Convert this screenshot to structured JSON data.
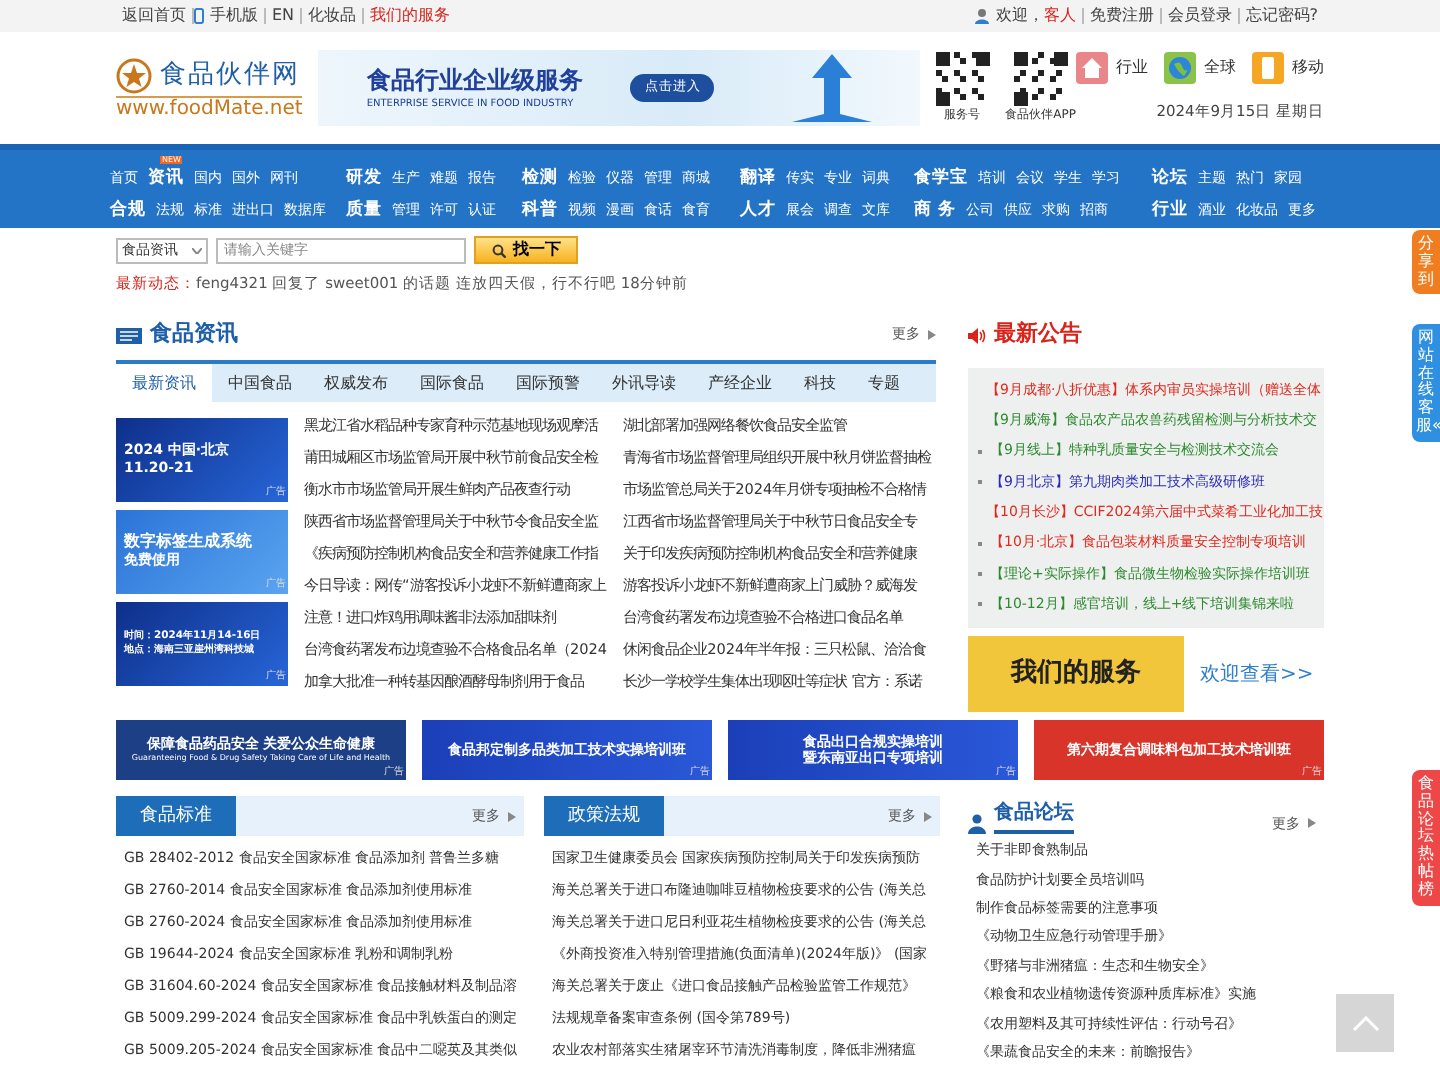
{
  "top_bar": {
    "left_links": [
      {
        "label": "返回首页",
        "kind": "text"
      },
      {
        "label": "手机版",
        "kind": "mobile"
      },
      {
        "label": "EN",
        "kind": "text"
      },
      {
        "label": "化妆品",
        "kind": "text"
      },
      {
        "label": "我们的服务",
        "kind": "highlight"
      }
    ],
    "greeting": "欢迎，",
    "guest": "客人",
    "right_links": [
      "免费注册",
      "会员登录",
      "忘记密码?"
    ]
  },
  "header": {
    "logo_name": "食品伙伴网",
    "logo_url": "www.foodMate.net",
    "banner": {
      "title": "食品行业企业级服务",
      "subtitle": "ENTERPRISE SERVICE IN FOOD INDUSTRY",
      "button": "点击进入"
    },
    "qr_codes": [
      "服务号",
      "食品伙伴APP"
    ],
    "shortcuts": [
      {
        "label": "行业",
        "kind": "house"
      },
      {
        "label": "全球",
        "kind": "globe"
      },
      {
        "label": "移动",
        "kind": "phone"
      }
    ],
    "date": "2024年9月15日 星期日"
  },
  "nav": [
    {
      "rows": [
        [
          {
            "label": "首页",
            "bold": false
          },
          {
            "label": "资讯",
            "bold": true,
            "badge": "NEW"
          },
          {
            "label": "国内",
            "bold": false
          },
          {
            "label": "国外",
            "bold": false
          },
          {
            "label": "网刊",
            "bold": false
          }
        ],
        [
          {
            "label": "合规",
            "bold": true
          },
          {
            "label": "法规",
            "bold": false
          },
          {
            "label": "标准",
            "bold": false
          },
          {
            "label": "进出口",
            "bold": false
          },
          {
            "label": "数据库",
            "bold": false
          }
        ]
      ]
    },
    {
      "rows": [
        [
          {
            "label": "研发",
            "bold": true
          },
          {
            "label": "生产",
            "bold": false
          },
          {
            "label": "难题",
            "bold": false
          },
          {
            "label": "报告",
            "bold": false
          }
        ],
        [
          {
            "label": "质量",
            "bold": true
          },
          {
            "label": "管理",
            "bold": false
          },
          {
            "label": "许可",
            "bold": false
          },
          {
            "label": "认证",
            "bold": false
          }
        ]
      ]
    },
    {
      "rows": [
        [
          {
            "label": "检测",
            "bold": true
          },
          {
            "label": "检验",
            "bold": false
          },
          {
            "label": "仪器",
            "bold": false
          },
          {
            "label": "管理",
            "bold": false
          },
          {
            "label": "商城",
            "bold": false
          }
        ],
        [
          {
            "label": "科普",
            "bold": true
          },
          {
            "label": "视频",
            "bold": false
          },
          {
            "label": "漫画",
            "bold": false
          },
          {
            "label": "食话",
            "bold": false
          },
          {
            "label": "食育",
            "bold": false
          }
        ]
      ]
    },
    {
      "rows": [
        [
          {
            "label": "翻译",
            "bold": true
          },
          {
            "label": "传实",
            "bold": false
          },
          {
            "label": "专业",
            "bold": false
          },
          {
            "label": "词典",
            "bold": false
          }
        ],
        [
          {
            "label": "人才",
            "bold": true
          },
          {
            "label": "展会",
            "bold": false
          },
          {
            "label": "调查",
            "bold": false
          },
          {
            "label": "文库",
            "bold": false
          }
        ]
      ]
    },
    {
      "rows": [
        [
          {
            "label": "食学宝",
            "bold": true
          },
          {
            "label": "培训",
            "bold": false
          },
          {
            "label": "会议",
            "bold": false
          },
          {
            "label": "学生",
            "bold": false
          },
          {
            "label": "学习",
            "bold": false
          }
        ],
        [
          {
            "label": "商 务",
            "bold": true
          },
          {
            "label": "公司",
            "bold": false
          },
          {
            "label": "供应",
            "bold": false
          },
          {
            "label": "求购",
            "bold": false
          },
          {
            "label": "招商",
            "bold": false
          }
        ]
      ]
    },
    {
      "rows": [
        [
          {
            "label": "论坛",
            "bold": true
          },
          {
            "label": "主题",
            "bold": false
          },
          {
            "label": "热门",
            "bold": false
          },
          {
            "label": "家园",
            "bold": false
          }
        ],
        [
          {
            "label": "行业",
            "bold": true
          },
          {
            "label": "酒业",
            "bold": false
          },
          {
            "label": "化妆品",
            "bold": false
          },
          {
            "label": "更多",
            "bold": false
          }
        ]
      ]
    }
  ],
  "search": {
    "category": "食品资讯",
    "placeholder": "请输入关键字",
    "button": "找一下"
  },
  "latest": {
    "label": "最新动态：",
    "user": "feng4321",
    "action": "回复了",
    "target_user": "sweet001",
    "middle": "的话题",
    "topic": "连放四天假，行不行吧",
    "time": "18分钟前"
  },
  "news": {
    "title": "食品资讯",
    "more": "更多",
    "tabs": [
      {
        "label": "最新资讯",
        "selected": true
      },
      {
        "label": "中国食品",
        "selected": false
      },
      {
        "label": "权威发布",
        "selected": false
      },
      {
        "label": "国际食品",
        "selected": false
      },
      {
        "label": "国际预警",
        "selected": false
      },
      {
        "label": "外讯导读",
        "selected": false
      },
      {
        "label": "产经企业",
        "selected": false
      },
      {
        "label": "科技",
        "selected": false
      },
      {
        "label": "专题",
        "selected": false
      }
    ],
    "ads": [
      {
        "kind": "dark",
        "lines": [
          "2024 中国·北京",
          "11.20-21"
        ],
        "tag": "广告"
      },
      {
        "kind": "light",
        "lines": [
          "数字标签生成系统",
          "免费使用"
        ],
        "tag": "广告"
      },
      {
        "kind": "dark",
        "lines": [
          "时间：2024年11月14-16日",
          "地点：海南三亚崖州湾科技城"
        ],
        "tag": "广告"
      }
    ],
    "columns": [
      [
        "黑龙江省水稻品种专家育种示范基地现场观摩活",
        "莆田城厢区市场监管局开展中秋节前食品安全检",
        "衡水市市场监管局开展生鲜肉产品夜查行动",
        "陕西省市场监督管理局关于中秋节令食品安全监",
        "《疾病预防控制机构食品安全和营养健康工作指",
        "今日导读：网传“游客投诉小龙虾不新鲜遭商家上",
        "注意！进口炸鸡用调味酱非法添加甜味剂",
        "台湾食药署发布边境查验不合格食品名单（2024",
        "加拿大批准一种转基因酿酒酵母制剂用于食品"
      ],
      [
        "湖北部署加强网络餐饮食品安全监管",
        "青海省市场监督管理局组织开展中秋月饼监督抽检",
        "市场监管总局关于2024年月饼专项抽检不合格情",
        "江西省市场监督管理局关于中秋节日食品安全专",
        "关于印发疾病预防控制机构食品安全和营养健康",
        "游客投诉小龙虾不新鲜遭商家上门威胁？威海发",
        "台湾食药署发布边境查验不合格进口食品名单",
        "休闲食品企业2024年半年报：三只松鼠、洽洽食",
        "长沙一学校学生集体出现呕吐等症状 官方：系诺"
      ]
    ]
  },
  "notices": {
    "title": "最新公告",
    "items": [
      {
        "text": "【9月成都·八折优惠】体系内审员实操培训（赠送全体",
        "color": "#e02a1f"
      },
      {
        "text": "【9月威海】食品农产品农兽药残留检测与分析技术交",
        "color": "#2f8a2f"
      },
      {
        "text": "【9月线上】特种乳质量安全与检测技术交流会",
        "color": "#2f8a2f"
      },
      {
        "text": "【9月北京】第九期肉类加工技术高级研修班",
        "color": "#2b2bb5"
      },
      {
        "text": "【10月长沙】CCIF2024第六届中式菜肴工业化加工技",
        "color": "#e02a1f"
      },
      {
        "text": "【10月·北京】食品包装材料质量安全控制专项培训",
        "color": "#e02a1f"
      },
      {
        "text": "【理论+实际操作】食品微生物检验实际操作培训班",
        "color": "#2f8a2f"
      },
      {
        "text": "【10-12月】感官培训，线上+线下培训集锦来啦",
        "color": "#2f8a2f"
      }
    ]
  },
  "service": {
    "title": "我们的服务",
    "link": "欢迎查看>>"
  },
  "banners": [
    {
      "kind": "navy",
      "lines": [
        "保障食品药品安全  关爱公众生命健康",
        "Guaranteeing Food & Drug Safety  Taking Care of Life and Health"
      ],
      "tag": "广告"
    },
    {
      "kind": "blue",
      "lines": [
        "食品邦定制多品类加工技术实操培训班"
      ],
      "tag": "广告"
    },
    {
      "kind": "blue",
      "lines": [
        "食品出口合规实操培训",
        "暨东南亚出口专项培训"
      ],
      "tag": "广告"
    },
    {
      "kind": "red",
      "lines": [
        "第六期复合调味料包加工技术培训班"
      ],
      "tag": "广告"
    }
  ],
  "sections": [
    {
      "kind": "tab",
      "title": "食品标准",
      "more": "更多",
      "items": [
        "GB 28402-2012 食品安全国家标准 食品添加剂 普鲁兰多糖",
        "GB 2760-2014 食品安全国家标准 食品添加剂使用标准",
        "GB 2760-2024 食品安全国家标准 食品添加剂使用标准",
        "GB 19644-2024 食品安全国家标准 乳粉和调制乳粉",
        "GB 31604.60-2024 食品安全国家标准 食品接触材料及制品溶",
        "GB 5009.299-2024 食品安全国家标准 食品中乳铁蛋白的测定",
        "GB 5009.205-2024 食品安全国家标准 食品中二噁英及其类似"
      ]
    },
    {
      "kind": "tab",
      "title": "政策法规",
      "more": "更多",
      "items": [
        "国家卫生健康委员会 国家疾病预防控制局关于印发疾病预防",
        "海关总署关于进口布隆迪咖啡豆植物检疫要求的公告 (海关总",
        "海关总署关于进口尼日利亚花生植物检疫要求的公告 (海关总",
        "《外商投资准入特别管理措施(负面清单)(2024年版)》 (国家",
        "海关总署关于废止《进口食品接触产品检验监管工作规范》",
        "法规规章备案审查条例 (国令第789号)",
        "农业农村部落实生猪屠宰环节清洗消毒制度，降低非洲猪瘟"
      ]
    },
    {
      "kind": "forum",
      "title": "食品论坛",
      "more": "更多",
      "items": [
        "关于非即食熟制品",
        "食品防护计划要全员培训吗",
        "制作食品标签需要的注意事项",
        "《动物卫生应急行动管理手册》",
        "《野猪与非洲猪瘟：生态和生物安全》",
        "《粮食和农业植物遗传资源种质库标准》实施",
        "《农用塑料及其可持续性评估：行动号召》",
        "《果蔬食品安全的未来：前瞻报告》"
      ]
    }
  ],
  "side_tabs": [
    {
      "label": "分享到",
      "color": "#f07d1f"
    },
    {
      "label": "网站在线客服«",
      "color": "#2f8fe0"
    },
    {
      "label": "食品论坛热帖榜",
      "color": "#ee4747"
    }
  ]
}
